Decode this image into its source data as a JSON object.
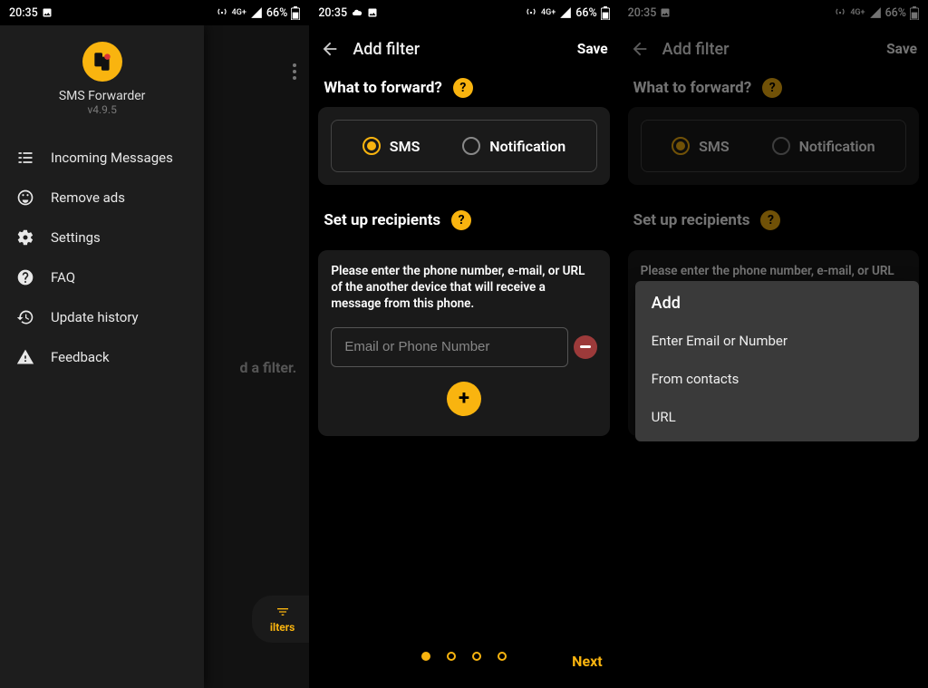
{
  "status": {
    "time": "20:35",
    "battery": "66%"
  },
  "screen1": {
    "drawer": {
      "app_name": "SMS Forwarder",
      "version": "v4.9.5",
      "items": [
        {
          "label": "Incoming Messages"
        },
        {
          "label": "Remove ads"
        },
        {
          "label": "Settings"
        },
        {
          "label": "FAQ"
        },
        {
          "label": "Update history"
        },
        {
          "label": "Feedback"
        }
      ]
    },
    "peek_text": "d a filter.",
    "filters_label": "ilters"
  },
  "addfilter": {
    "title": "Add filter",
    "save": "Save",
    "what_title": "What to forward?",
    "radio_sms": "SMS",
    "radio_notification": "Notification",
    "recipients_title": "Set up recipients",
    "recipients_desc": "Please enter the phone number, e-mail, or URL of the another device that will receive a message from this phone.",
    "input_placeholder": "Email or Phone Number",
    "next": "Next"
  },
  "popup": {
    "title": "Add",
    "items": [
      {
        "label": "Enter Email or Number"
      },
      {
        "label": "From contacts"
      },
      {
        "label": "URL"
      }
    ]
  }
}
